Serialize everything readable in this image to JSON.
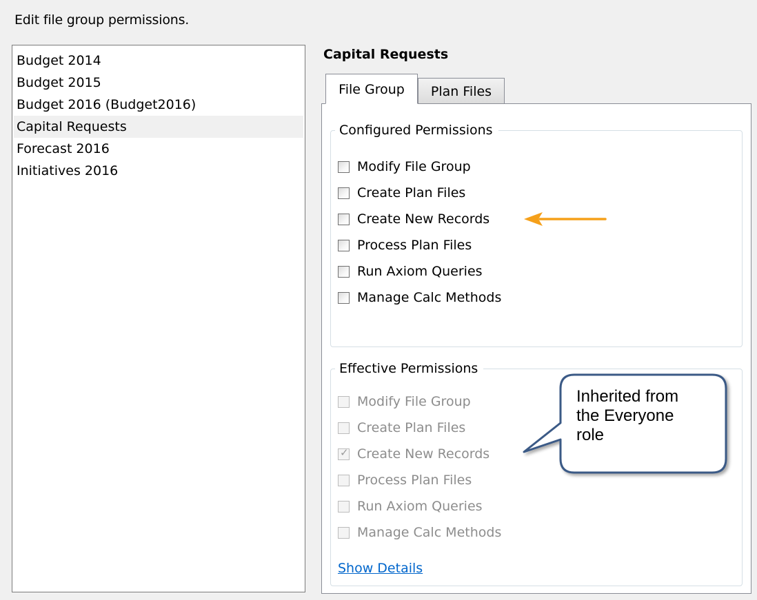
{
  "instruction": "Edit file group permissions.",
  "file_groups": [
    {
      "label": "Budget 2014",
      "selected": false
    },
    {
      "label": "Budget 2015",
      "selected": false
    },
    {
      "label": "Budget 2016 (Budget2016)",
      "selected": false
    },
    {
      "label": "Capital Requests",
      "selected": true
    },
    {
      "label": "Forecast 2016",
      "selected": false
    },
    {
      "label": "Initiatives 2016",
      "selected": false
    }
  ],
  "selected_group_title": "Capital Requests",
  "tabs": [
    {
      "label": "File Group",
      "active": true
    },
    {
      "label": "Plan Files",
      "active": false
    }
  ],
  "configured": {
    "legend": "Configured Permissions",
    "items": [
      {
        "label": "Modify File Group",
        "checked": false
      },
      {
        "label": "Create Plan Files",
        "checked": false
      },
      {
        "label": "Create New Records",
        "checked": false
      },
      {
        "label": "Process Plan Files",
        "checked": false
      },
      {
        "label": "Run Axiom Queries",
        "checked": false
      },
      {
        "label": "Manage Calc Methods",
        "checked": false
      }
    ]
  },
  "effective": {
    "legend": "Effective Permissions",
    "items": [
      {
        "label": "Modify File Group",
        "checked": false
      },
      {
        "label": "Create Plan Files",
        "checked": false
      },
      {
        "label": "Create New Records",
        "checked": true
      },
      {
        "label": "Process Plan Files",
        "checked": false
      },
      {
        "label": "Run Axiom Queries",
        "checked": false
      },
      {
        "label": "Manage Calc Methods",
        "checked": false
      }
    ],
    "show_details_label": "Show Details"
  },
  "annotation": {
    "callout_lines": [
      "Inherited from",
      "the Everyone",
      "role"
    ],
    "arrow_color": "#f5a01a",
    "callout_border_color": "#3b5a86"
  }
}
